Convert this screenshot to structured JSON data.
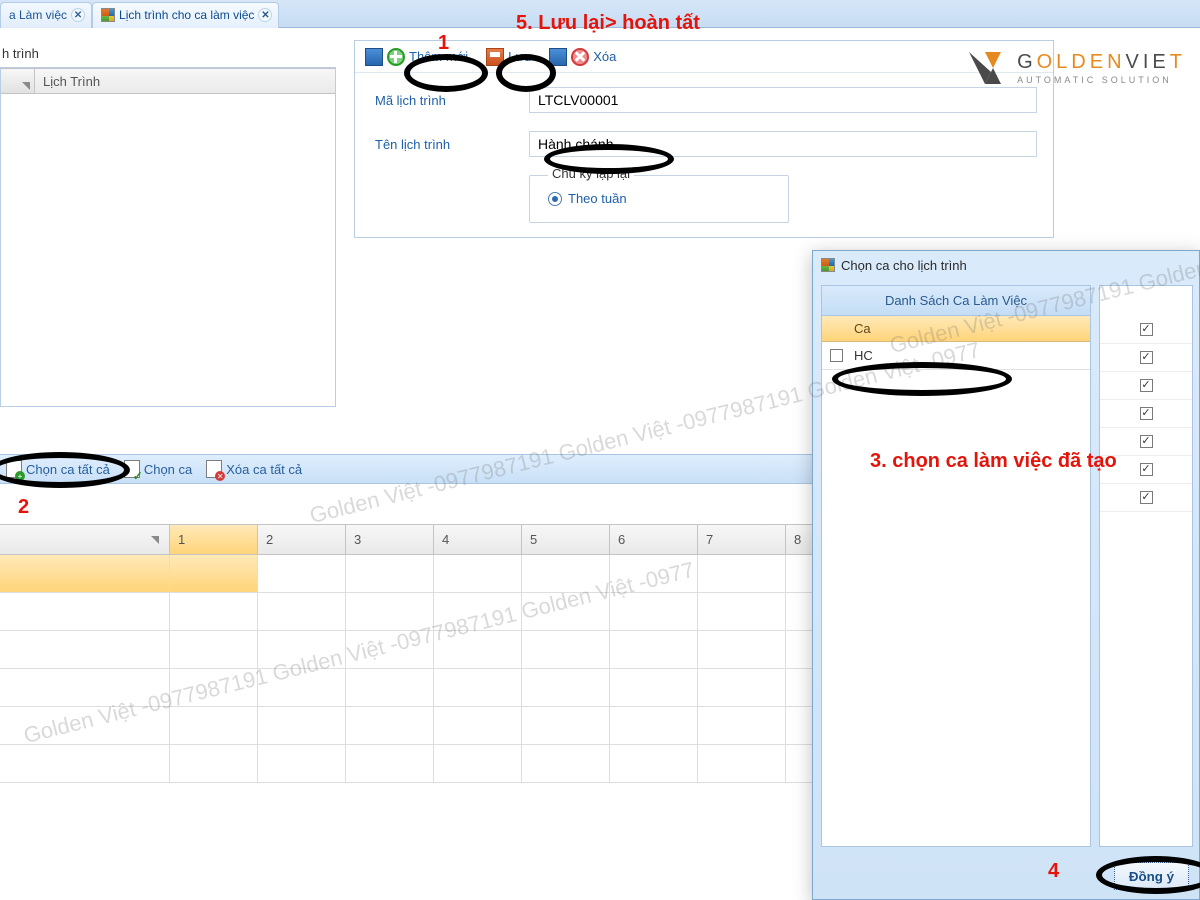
{
  "tabs": [
    {
      "label": "a Làm việc"
    },
    {
      "label": "Lịch trình cho ca làm việc"
    }
  ],
  "left_panel": {
    "section_title": "h trình",
    "column": "Lịch Trình"
  },
  "toolbar": {
    "add": "Thêm mới",
    "save": "Lưu",
    "delete": "Xóa"
  },
  "form": {
    "code_label": "Mã lịch trình",
    "code_value": "LTCLV00001",
    "name_label": "Tên lịch trình",
    "name_value": "Hành chánh",
    "group_title": "Chu kỳ lặp lại",
    "radio_label": "Theo tuần"
  },
  "logo": {
    "brand_a": "G",
    "brand_b": "OLDEN",
    "brand_c": "VIE",
    "brand_d": "T",
    "sub": "AUTOMATIC SOLUTION"
  },
  "subtoolbar": {
    "select_all": "Chọn ca tất cả",
    "select": "Chọn ca",
    "delete_all": "Xóa ca tất cả"
  },
  "schedule": {
    "cols": [
      "1",
      "2",
      "3",
      "4",
      "5",
      "6",
      "7",
      "8"
    ]
  },
  "dialog": {
    "title": "Chọn ca cho lịch trình",
    "list_title": "Danh Sách Ca Làm Việc",
    "col": "Ca",
    "item": "HC",
    "ok": "Đồng ý"
  },
  "annotations": {
    "a1": "1",
    "a2": "2",
    "a3": "3. chọn ca làm việc đã tạo",
    "a4": "4",
    "a5": "5. Lưu lại> hoàn tất"
  },
  "watermark": "Golden Việt -0977987191 Golden Việt -0977987191 Golden Việt -0977"
}
